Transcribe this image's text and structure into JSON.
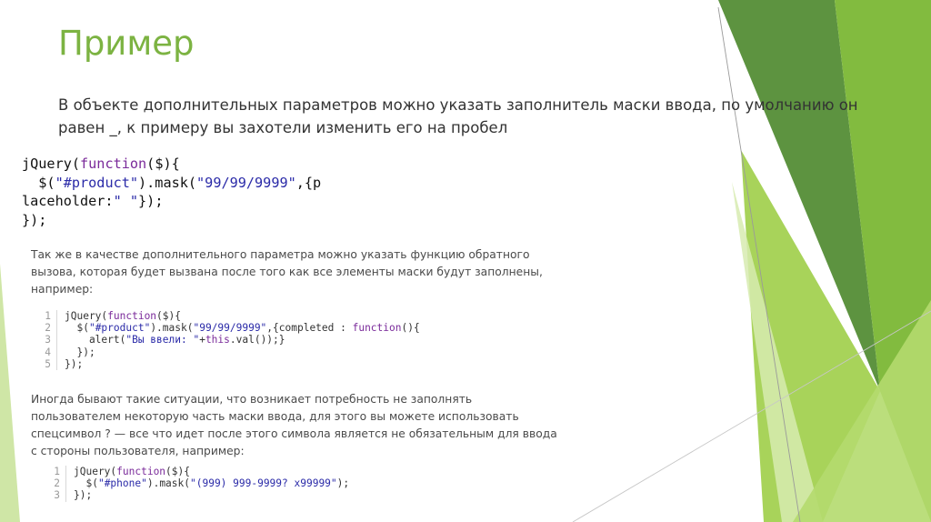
{
  "slide": {
    "title": "Пример",
    "lead": "В объекте дополнительных параметров можно указать заполнитель маски ввода, по умолчанию он равен _, к примеру вы захотели изменить его на пробел",
    "code_main": [
      [
        {
          "t": "jQuery("
        },
        {
          "t": "function",
          "c": "kw"
        },
        {
          "t": "($){"
        }
      ],
      [
        {
          "t": "  $("
        },
        {
          "t": "\"#product\"",
          "c": "str"
        },
        {
          "t": ").mask("
        },
        {
          "t": "\"99/99/9999\"",
          "c": "str"
        },
        {
          "t": ",{p"
        }
      ],
      [
        {
          "t": "laceholder:"
        },
        {
          "t": "\" \"",
          "c": "str"
        },
        {
          "t": "});"
        }
      ],
      [
        {
          "t": "});"
        }
      ]
    ],
    "para1": "Так же в качестве дополнительного параметра можно указать функцию обратного вызова, которая будет вызвана после того как все элементы маски будут заполнены, например:",
    "snippet1": [
      {
        "n": "1",
        "parts": [
          {
            "t": "jQuery("
          },
          {
            "t": "function",
            "c": "kw"
          },
          {
            "t": "($){"
          }
        ]
      },
      {
        "n": "2",
        "parts": [
          {
            "t": "  $("
          },
          {
            "t": "\"#product\"",
            "c": "str"
          },
          {
            "t": ").mask("
          },
          {
            "t": "\"99/99/9999\"",
            "c": "str"
          },
          {
            "t": ",{completed : "
          },
          {
            "t": "function",
            "c": "kw"
          },
          {
            "t": "(){"
          }
        ]
      },
      {
        "n": "3",
        "parts": [
          {
            "t": "    alert("
          },
          {
            "t": "\"Вы ввели: \"",
            "c": "str"
          },
          {
            "t": "+"
          },
          {
            "t": "this",
            "c": "kw"
          },
          {
            "t": ".val());}"
          }
        ]
      },
      {
        "n": "4",
        "parts": [
          {
            "t": "  });"
          }
        ]
      },
      {
        "n": "5",
        "parts": [
          {
            "t": "});"
          }
        ]
      }
    ],
    "para2": "Иногда бывают такие ситуации, что возникает потребность не заполнять пользователем некоторую часть маски ввода, для этого вы можете использовать спецсимвол ? — все что идет после этого символа является не обязательным для ввода с стороны пользователя, например:",
    "snippet2": [
      {
        "n": "1",
        "parts": [
          {
            "t": "jQuery("
          },
          {
            "t": "function",
            "c": "kw"
          },
          {
            "t": "($){"
          }
        ]
      },
      {
        "n": "2",
        "parts": [
          {
            "t": "  $("
          },
          {
            "t": "\"#phone\"",
            "c": "str"
          },
          {
            "t": ").mask("
          },
          {
            "t": "\"(999) 999-9999? x99999\"",
            "c": "str"
          },
          {
            "t": ");"
          }
        ]
      },
      {
        "n": "3",
        "parts": [
          {
            "t": "});"
          }
        ]
      }
    ]
  },
  "colors": {
    "title": "#7cb342",
    "green_dark": "#5f8f3a",
    "green_mid": "#7db83e",
    "green_light": "#a8d45a",
    "green_pale": "#d3e9a3",
    "keyword": "#7a2a9a",
    "string": "#2a2aa8"
  }
}
